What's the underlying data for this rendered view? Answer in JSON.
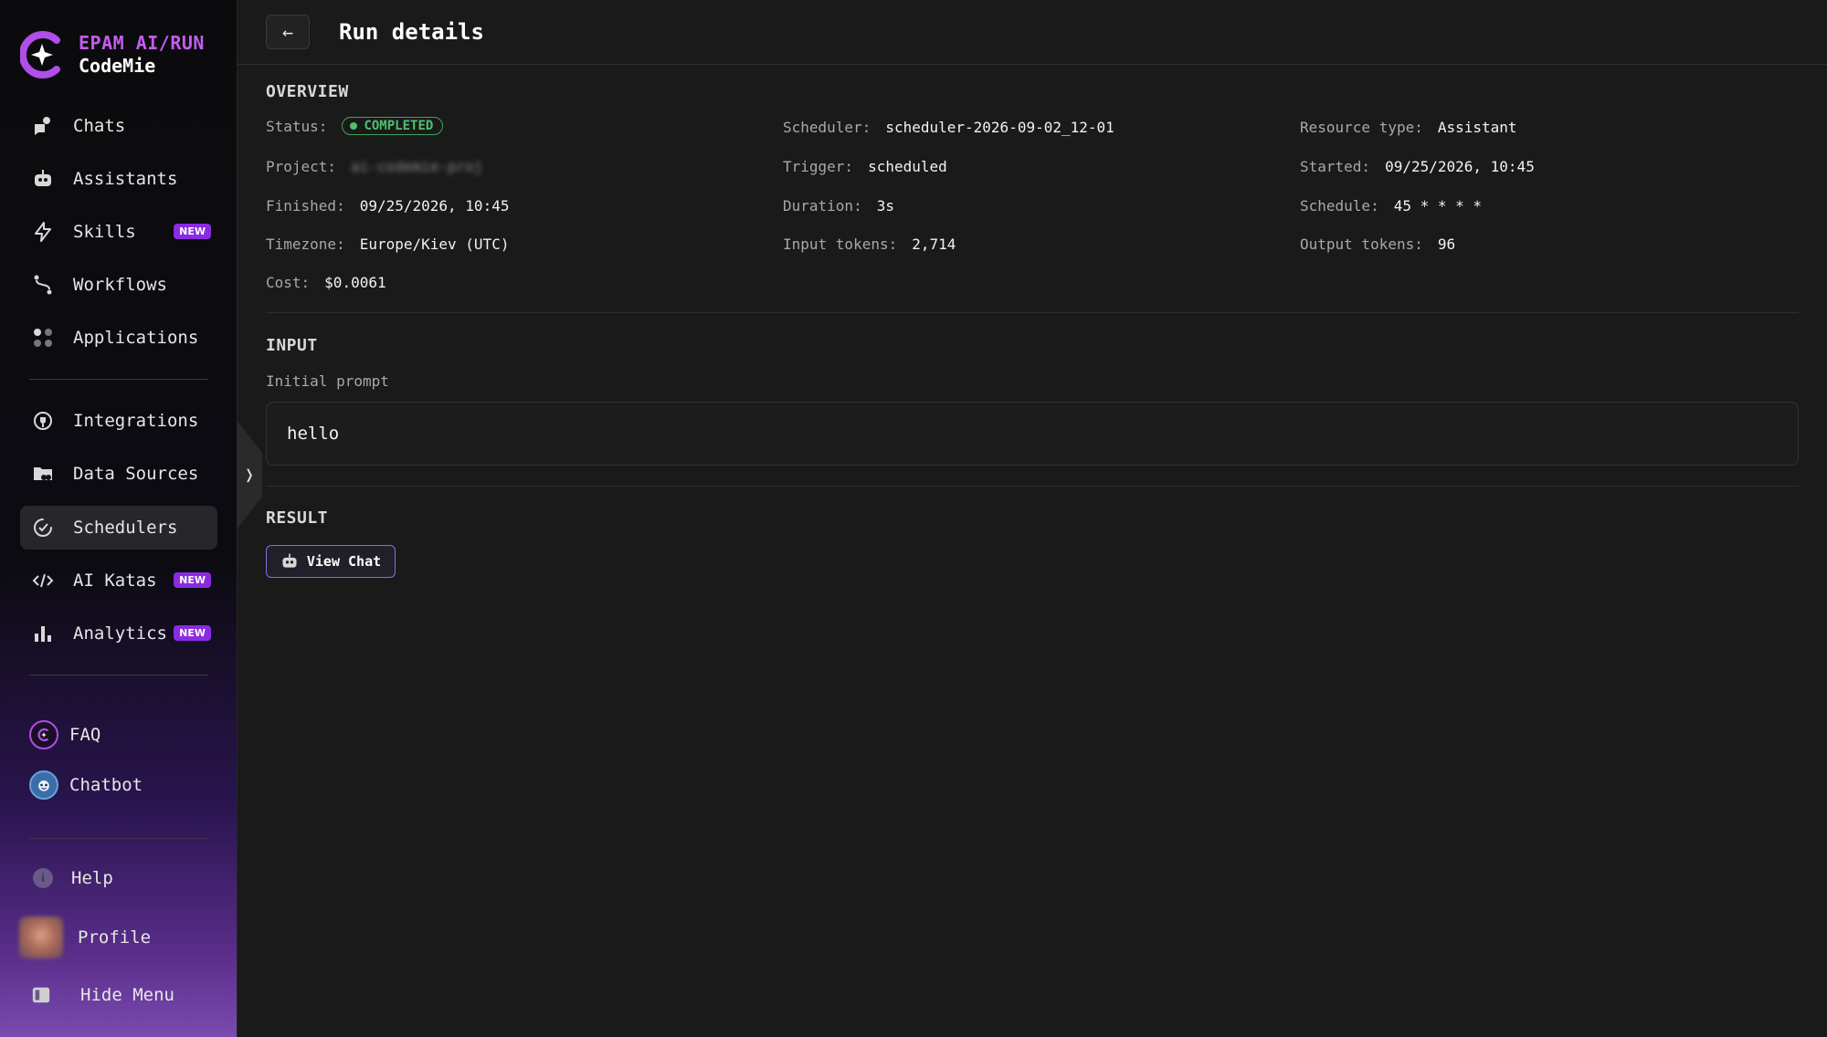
{
  "brand": {
    "line1": "EPAM AI/RUN",
    "line2": "CodeMie"
  },
  "nav": {
    "chats": "Chats",
    "assistants": "Assistants",
    "skills": "Skills",
    "workflows": "Workflows",
    "applications": "Applications",
    "integrations": "Integrations",
    "data_sources": "Data Sources",
    "schedulers": "Schedulers",
    "ai_katas": "AI Katas",
    "analytics": "Analytics",
    "new_badge": "NEW",
    "faq": "FAQ",
    "chatbot": "Chatbot",
    "help": "Help",
    "profile": "Profile",
    "hide_menu": "Hide Menu"
  },
  "header": {
    "title": "Run details",
    "back_icon": "←"
  },
  "collapse_icon": "❭",
  "overview": {
    "title": "OVERVIEW",
    "status_label": "Status:",
    "status_value": "COMPLETED",
    "scheduler_label": "Scheduler:",
    "scheduler_value": "scheduler-2026-09-02_12-01",
    "resource_type_label": "Resource type:",
    "resource_type_value": "Assistant",
    "project_label": "Project:",
    "project_value": "ai-codemie-proj",
    "trigger_label": "Trigger:",
    "trigger_value": "scheduled",
    "started_label": "Started:",
    "started_value": "09/25/2026, 10:45",
    "finished_label": "Finished:",
    "finished_value": "09/25/2026, 10:45",
    "duration_label": "Duration:",
    "duration_value": "3s",
    "schedule_label": "Schedule:",
    "schedule_value": "45 * * * *",
    "timezone_label": "Timezone:",
    "timezone_value": "Europe/Kiev (UTC)",
    "input_tokens_label": "Input tokens:",
    "input_tokens_value": "2,714",
    "output_tokens_label": "Output tokens:",
    "output_tokens_value": "96",
    "cost_label": "Cost:",
    "cost_value": "$0.0061"
  },
  "input": {
    "title": "INPUT",
    "prompt_label": "Initial prompt",
    "prompt_value": "hello"
  },
  "result": {
    "title": "RESULT",
    "view_chat": "View Chat"
  },
  "colors": {
    "accent": "#8a2be2",
    "brand": "#c45cf0",
    "success": "#4fc06c"
  }
}
